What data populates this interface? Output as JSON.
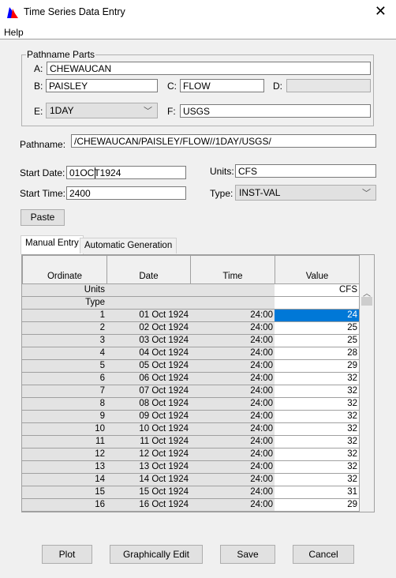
{
  "window": {
    "title": "Time Series Data Entry",
    "icon": "hec-dss-chart-icon"
  },
  "menu": {
    "help": "Help"
  },
  "pathname_parts": {
    "legend": "Pathname Parts",
    "a_label": "A:",
    "a": "CHEWAUCAN",
    "b_label": "B:",
    "b": "PAISLEY",
    "c_label": "C:",
    "c": "FLOW",
    "d_label": "D:",
    "d": "",
    "e_label": "E:",
    "e": "1DAY",
    "f_label": "F:",
    "f": "USGS"
  },
  "pathname": {
    "label": "Pathname:",
    "value": "/CHEWAUCAN/PAISLEY/FLOW//1DAY/USGS/"
  },
  "start_date": {
    "label": "Start Date:",
    "value": "01OCT1924"
  },
  "start_time": {
    "label": "Start Time:",
    "value": "2400"
  },
  "units": {
    "label": "Units:",
    "value": "CFS"
  },
  "type": {
    "label": "Type:",
    "value": "INST-VAL"
  },
  "paste_label": "Paste",
  "tabs": [
    {
      "label": "Manual Entry",
      "active": true
    },
    {
      "label": "Automatic Generation",
      "active": false
    }
  ],
  "table": {
    "columns": [
      "Ordinate",
      "Date",
      "Time",
      "Value"
    ],
    "units_row": {
      "label": "Units",
      "value": "CFS"
    },
    "type_row": {
      "label": "Type",
      "value": ""
    },
    "rows": [
      {
        "ordinate": "1",
        "date": "01 Oct 1924",
        "time": "24:00",
        "value": "24"
      },
      {
        "ordinate": "2",
        "date": "02 Oct 1924",
        "time": "24:00",
        "value": "25"
      },
      {
        "ordinate": "3",
        "date": "03 Oct 1924",
        "time": "24:00",
        "value": "25"
      },
      {
        "ordinate": "4",
        "date": "04 Oct 1924",
        "time": "24:00",
        "value": "28"
      },
      {
        "ordinate": "5",
        "date": "05 Oct 1924",
        "time": "24:00",
        "value": "29"
      },
      {
        "ordinate": "6",
        "date": "06 Oct 1924",
        "time": "24:00",
        "value": "32"
      },
      {
        "ordinate": "7",
        "date": "07 Oct 1924",
        "time": "24:00",
        "value": "32"
      },
      {
        "ordinate": "8",
        "date": "08 Oct 1924",
        "time": "24:00",
        "value": "32"
      },
      {
        "ordinate": "9",
        "date": "09 Oct 1924",
        "time": "24:00",
        "value": "32"
      },
      {
        "ordinate": "10",
        "date": "10 Oct 1924",
        "time": "24:00",
        "value": "32"
      },
      {
        "ordinate": "11",
        "date": "11 Oct 1924",
        "time": "24:00",
        "value": "32"
      },
      {
        "ordinate": "12",
        "date": "12 Oct 1924",
        "time": "24:00",
        "value": "32"
      },
      {
        "ordinate": "13",
        "date": "13 Oct 1924",
        "time": "24:00",
        "value": "32"
      },
      {
        "ordinate": "14",
        "date": "14 Oct 1924",
        "time": "24:00",
        "value": "32"
      },
      {
        "ordinate": "15",
        "date": "15 Oct 1924",
        "time": "24:00",
        "value": "31"
      },
      {
        "ordinate": "16",
        "date": "16 Oct 1924",
        "time": "24:00",
        "value": "29"
      }
    ],
    "selected_color": "#0078d7"
  },
  "buttons": {
    "plot": "Plot",
    "graph_edit": "Graphically Edit",
    "save": "Save",
    "cancel": "Cancel"
  }
}
